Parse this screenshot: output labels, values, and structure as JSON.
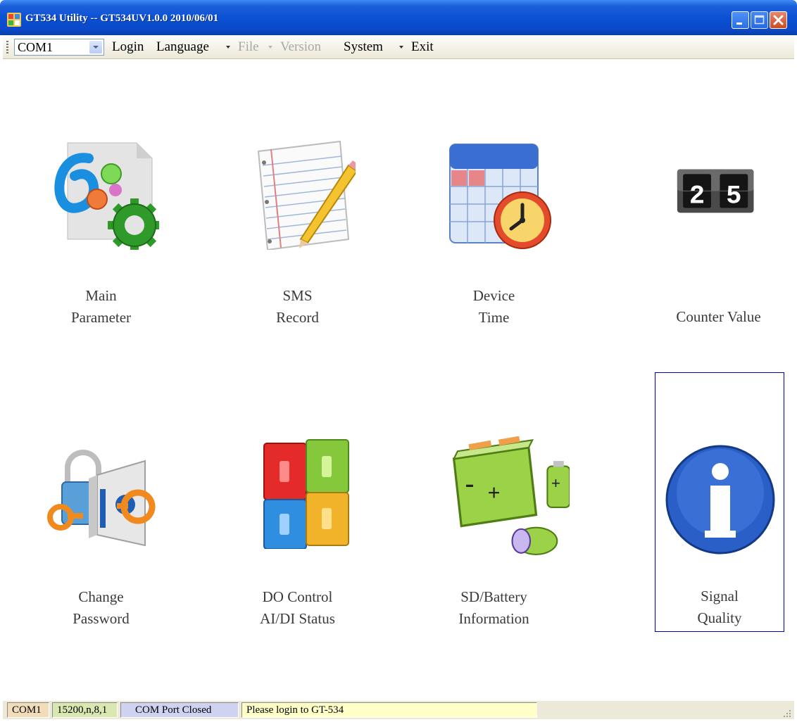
{
  "window": {
    "title": "GT534 Utility -- GT534UV1.0.0 2010/06/01"
  },
  "toolbar": {
    "port_select": {
      "value": "COM1"
    },
    "menu": [
      {
        "label": "Login",
        "enabled": true
      },
      {
        "label": "Language",
        "enabled": true,
        "has_dropdown": true
      },
      {
        "label": "File",
        "enabled": false,
        "has_dropdown": true
      },
      {
        "label": "Version",
        "enabled": false
      },
      {
        "label": "System",
        "enabled": true,
        "has_dropdown": true
      },
      {
        "label": "Exit",
        "enabled": true
      }
    ]
  },
  "tiles": [
    {
      "id": "main-parameter",
      "icon": "settings-gear-icon",
      "lines": [
        "Main",
        "Parameter"
      ]
    },
    {
      "id": "sms-record",
      "icon": "notepad-pencil-icon",
      "lines": [
        "SMS",
        "Record"
      ]
    },
    {
      "id": "device-time",
      "icon": "calendar-clock-icon",
      "lines": [
        "Device",
        "Time"
      ]
    },
    {
      "id": "counter-value",
      "icon": "flip-counter-icon",
      "lines": [
        "Counter Value"
      ],
      "counter_digits": "25"
    },
    {
      "id": "change-password",
      "icon": "lock-key-icon",
      "lines": [
        "Change",
        "Password"
      ]
    },
    {
      "id": "do-control",
      "icon": "switch-panel-icon",
      "lines": [
        "DO Control",
        "AI/DI Status"
      ]
    },
    {
      "id": "sd-battery",
      "icon": "battery-icon",
      "lines": [
        "SD/Battery",
        "Information"
      ]
    },
    {
      "id": "signal-quality",
      "icon": "info-icon",
      "lines": [
        "Signal",
        "Quality"
      ],
      "selected": true
    }
  ],
  "statusbar": {
    "port": "COM1",
    "settings": "15200,n,8,1",
    "state": "COM Port Closed",
    "message": "Please login to GT-534"
  },
  "colors": {
    "titlebar": "#0a4fd3",
    "selection_border": "#0000a8",
    "menu_disabled": "#a7a7a7"
  }
}
